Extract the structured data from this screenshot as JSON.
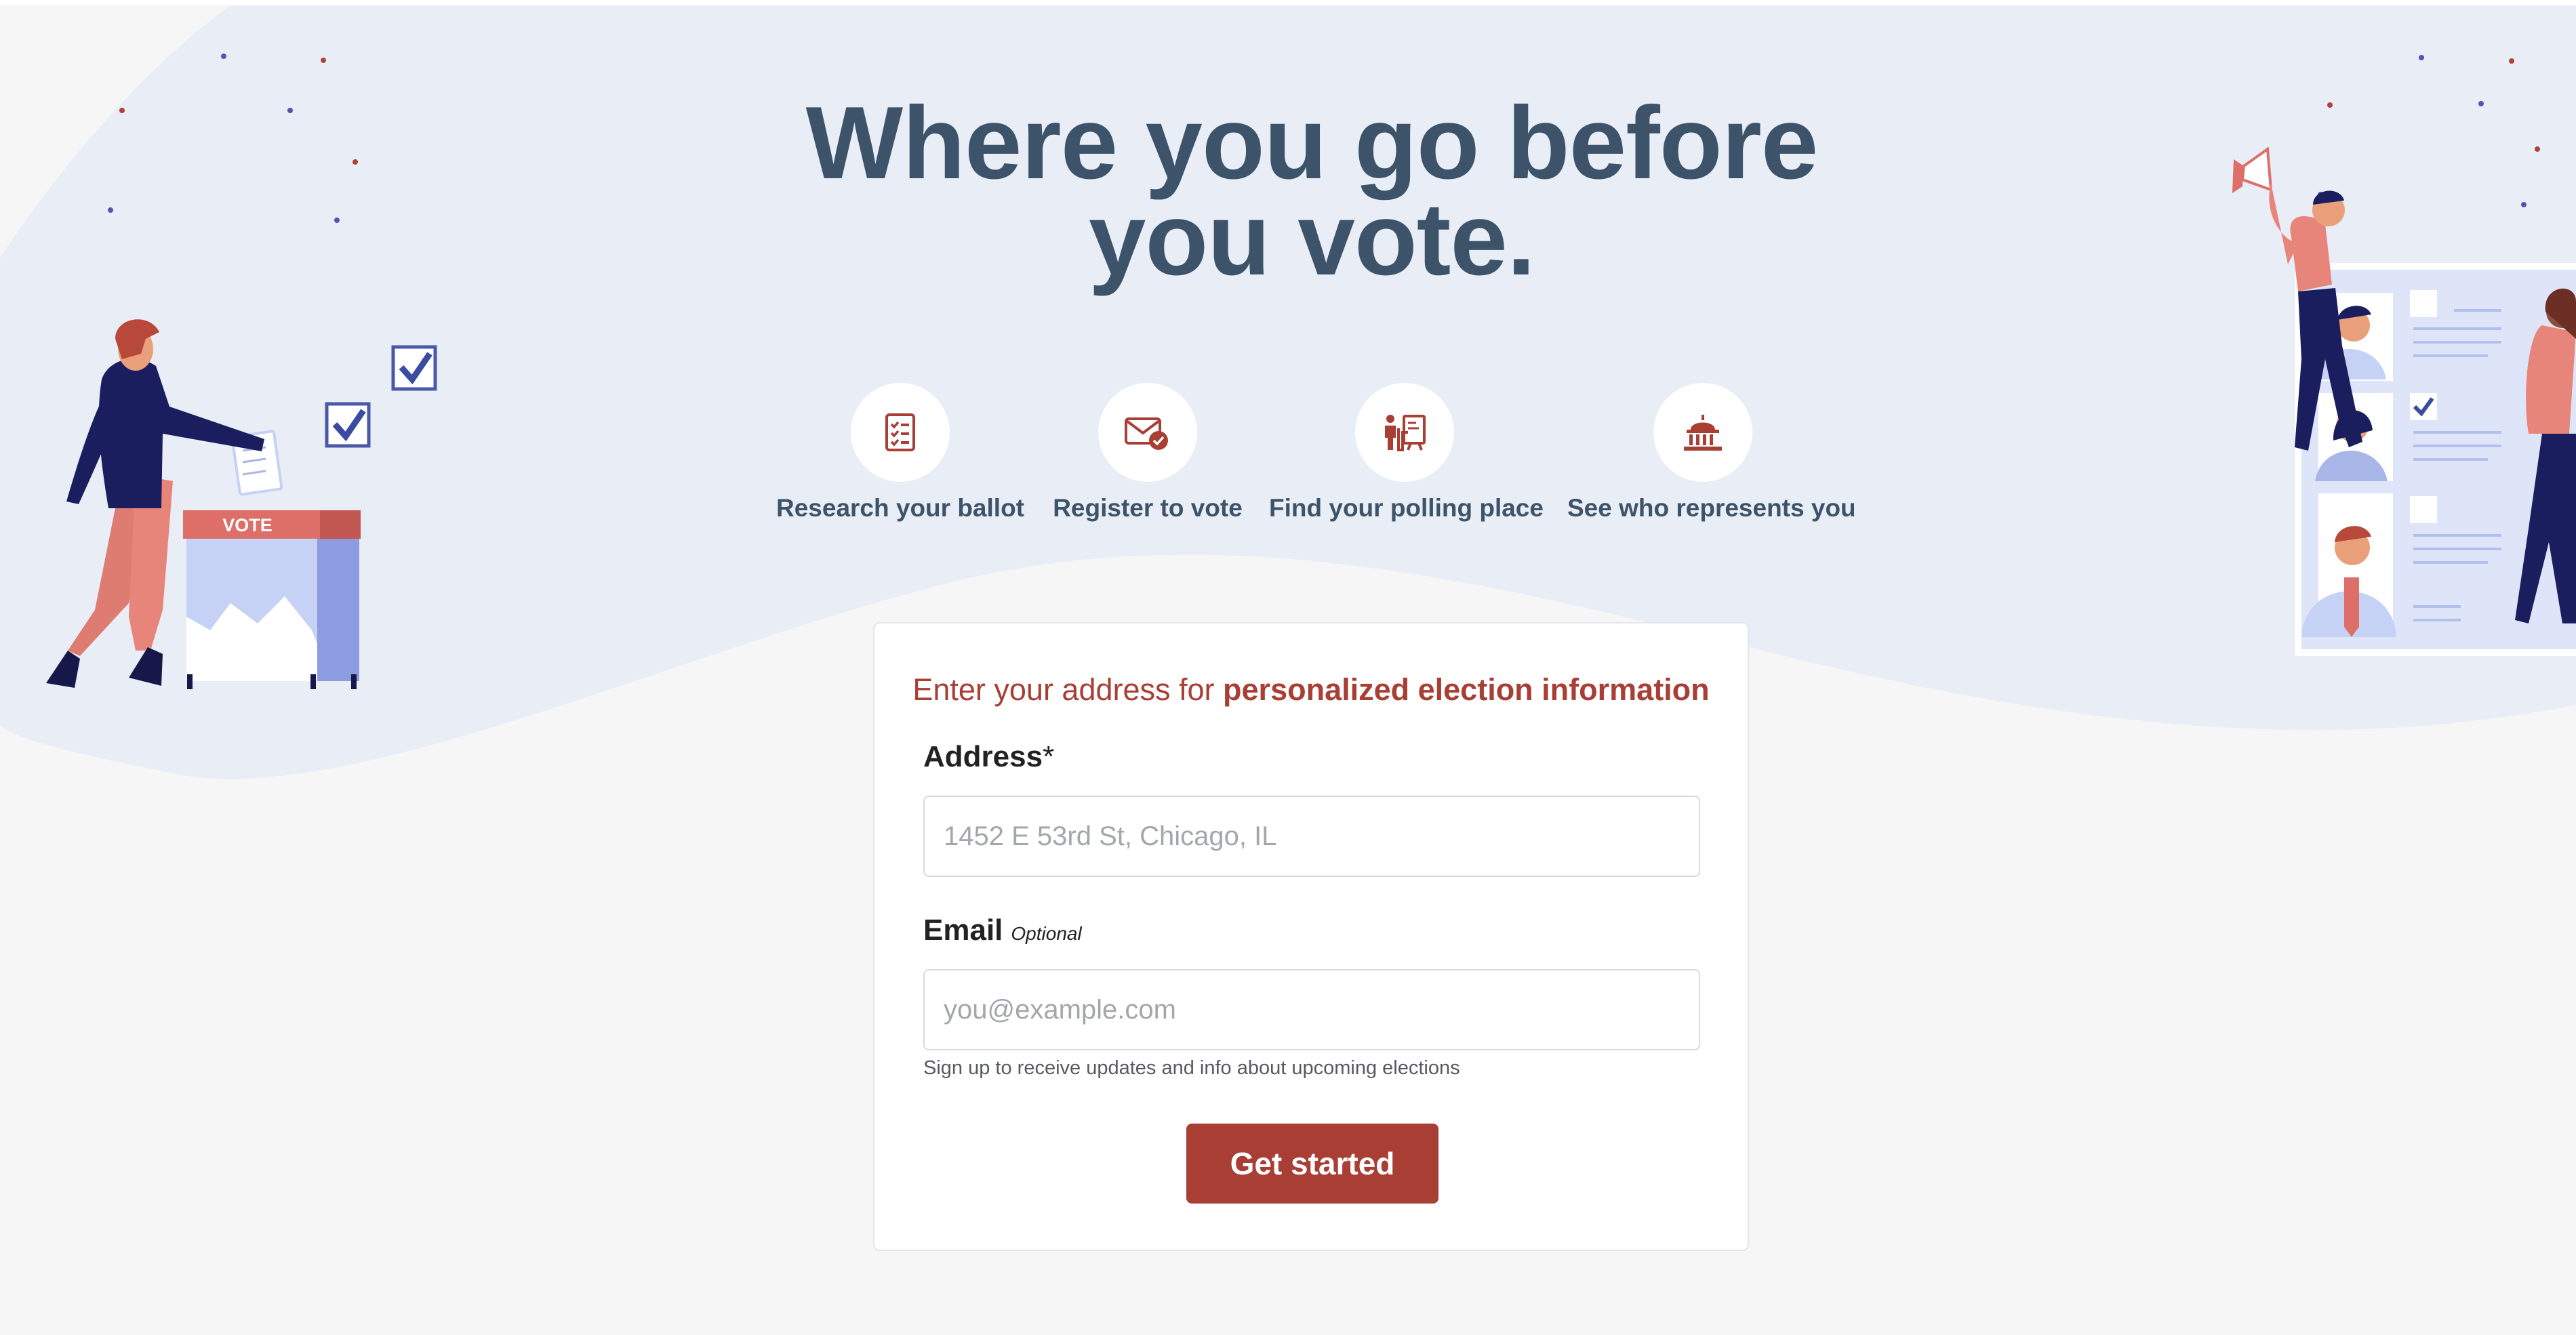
{
  "hero": {
    "title": "Where you go before you vote."
  },
  "features": [
    {
      "label": "Research your ballot",
      "icon": "ballot-list-icon"
    },
    {
      "label": "Register to vote",
      "icon": "envelope-check-icon"
    },
    {
      "label": "Find your polling place",
      "icon": "polling-booth-icon"
    },
    {
      "label": "See who represents you",
      "icon": "capitol-building-icon"
    }
  ],
  "illustrations": {
    "ballot_box_sign": "VOTE"
  },
  "form": {
    "heading_prefix": "Enter your address for ",
    "heading_emphasis": "personalized election information",
    "address": {
      "label": "Address",
      "required_mark": "*",
      "placeholder": "1452 E 53rd St, Chicago, IL",
      "value": ""
    },
    "email": {
      "label": "Email",
      "optional_tag": "Optional",
      "placeholder": "you@example.com",
      "value": ""
    },
    "help_text": "Sign up to receive updates and info about upcoming elections",
    "submit_label": "Get started"
  },
  "colors": {
    "accent": "#a83e34",
    "heading": "#3c5369",
    "hero_background": "#e8edf6",
    "page_background": "#f6f6f6"
  }
}
